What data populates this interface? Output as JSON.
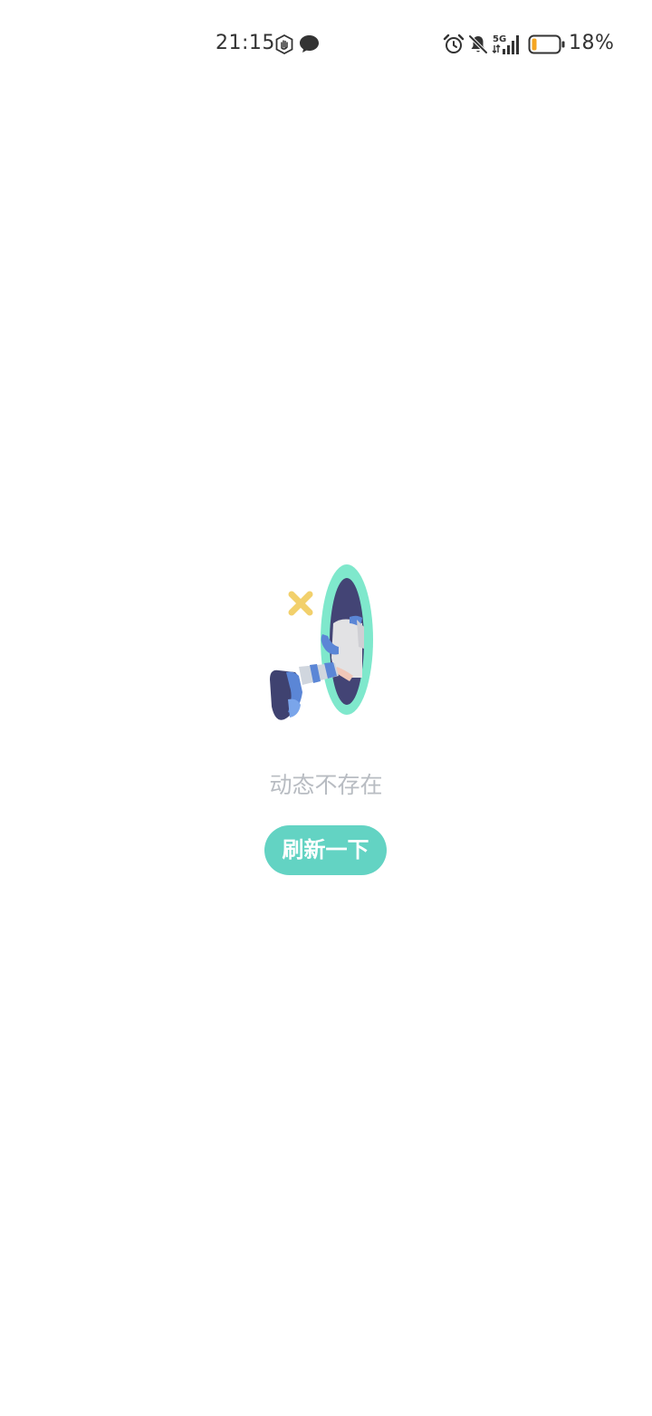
{
  "status_bar": {
    "time": "21:15",
    "network": "5G",
    "battery_percent": "18%",
    "battery_level": 0.18,
    "icons": [
      "accessibility-hand-icon",
      "message-bubble-icon",
      "alarm-icon",
      "mute-bell-icon",
      "signal-icon",
      "battery-icon"
    ]
  },
  "empty_state": {
    "illustration": "portal-legs-illustration",
    "message": "动态不存在",
    "refresh_label": "刷新一下"
  },
  "colors": {
    "accent": "#63d3c3",
    "message_text": "#b8bcc2",
    "status_text": "#333333",
    "battery_low": "#f5a623"
  }
}
